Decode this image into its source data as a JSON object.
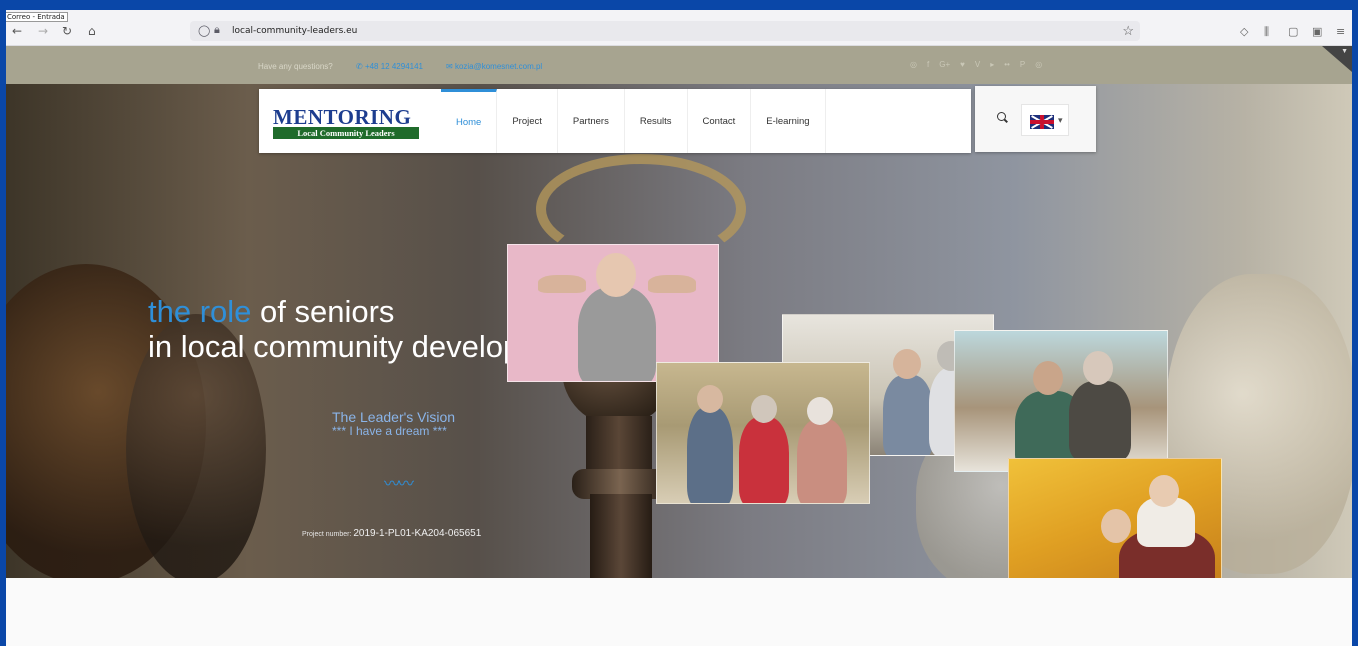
{
  "browser": {
    "tab_tooltip": "Correo - Entrada",
    "url": "local-community-leaders.eu"
  },
  "topbar": {
    "question": "Have any questions?",
    "phone": "+48 12 4294141",
    "email": "kozia@komesnet.com.pl"
  },
  "logo": {
    "main": "MENTORING",
    "sub": "Local Community Leaders"
  },
  "menu": {
    "items": [
      {
        "label": "Home",
        "active": true
      },
      {
        "label": "Project",
        "active": false
      },
      {
        "label": "Partners",
        "active": false
      },
      {
        "label": "Results",
        "active": false
      },
      {
        "label": "Contact",
        "active": false
      },
      {
        "label": "E-learning",
        "active": false
      }
    ]
  },
  "hero": {
    "headline_accent": "the role",
    "headline_rest": " of seniors",
    "headline_line2": "in local community development.",
    "vision": "The Leader's Vision",
    "dream": "*** I have a dream ***",
    "project_label": "Project number:",
    "project_number": "2019-1-PL01-KA204-065651"
  },
  "slider": {
    "prev": "‹",
    "next": "›"
  },
  "colors": {
    "accent": "#2f8fd8",
    "frame": "#0a47a8",
    "topbar": "#a7a490"
  }
}
